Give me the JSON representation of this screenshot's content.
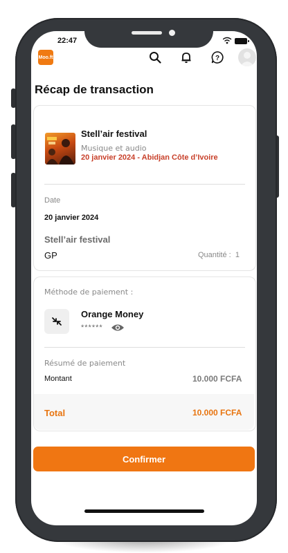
{
  "status_bar": {
    "time": "22:47"
  },
  "header": {
    "logo_text": "Moo.ft",
    "icons": [
      "search-icon",
      "bell-icon",
      "help-icon",
      "avatar-icon"
    ]
  },
  "page_title": "Récap de transaction",
  "event": {
    "name": "Stell’air festival",
    "category": "Musique et audio",
    "date_location": "20 janvier 2024 - Abidjan Côte d’Ivoire"
  },
  "details": {
    "date_label": "Date",
    "date_value": "20 janvier 2024",
    "event_name": "Stell’air festival",
    "ticket_type": "GP",
    "quantity_label": "Quantité :",
    "quantity_value": "1"
  },
  "payment": {
    "method_label": "Méthode de paiement :",
    "method_name": "Orange Money",
    "masked_number": "******",
    "summary_label": "Résumé de paiement",
    "amount_label": "Montant",
    "amount_value": "10.000 FCFA",
    "total_label": "Total",
    "total_value": "10.000 FCFA"
  },
  "confirm_button": "Confirmer",
  "colors": {
    "accent": "#f07612",
    "accent_text": "#e8740f",
    "date_red": "#c8402a"
  }
}
